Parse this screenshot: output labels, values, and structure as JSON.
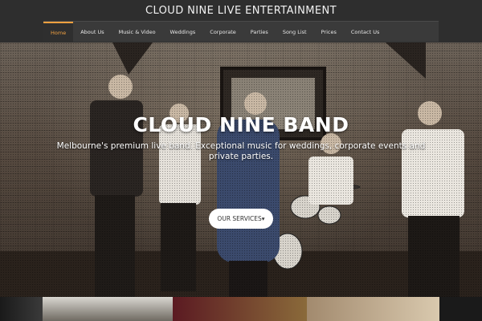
{
  "site": {
    "title": "CLOUD NINE LIVE ENTERTAINMENT"
  },
  "nav": {
    "items": [
      "Home",
      "About Us",
      "Music & Video",
      "Weddings",
      "Corporate",
      "Parties",
      "Song List",
      "Prices",
      "Contact Us"
    ],
    "active_index": 0,
    "accent_color": "#f0a040"
  },
  "hero": {
    "title": "CLOUD NINE BAND",
    "subtitle": "Melbourne's premium live band. Exceptional music for weddings, corporate events and private parties.",
    "cta_label": "OUR SERVICES▾"
  }
}
